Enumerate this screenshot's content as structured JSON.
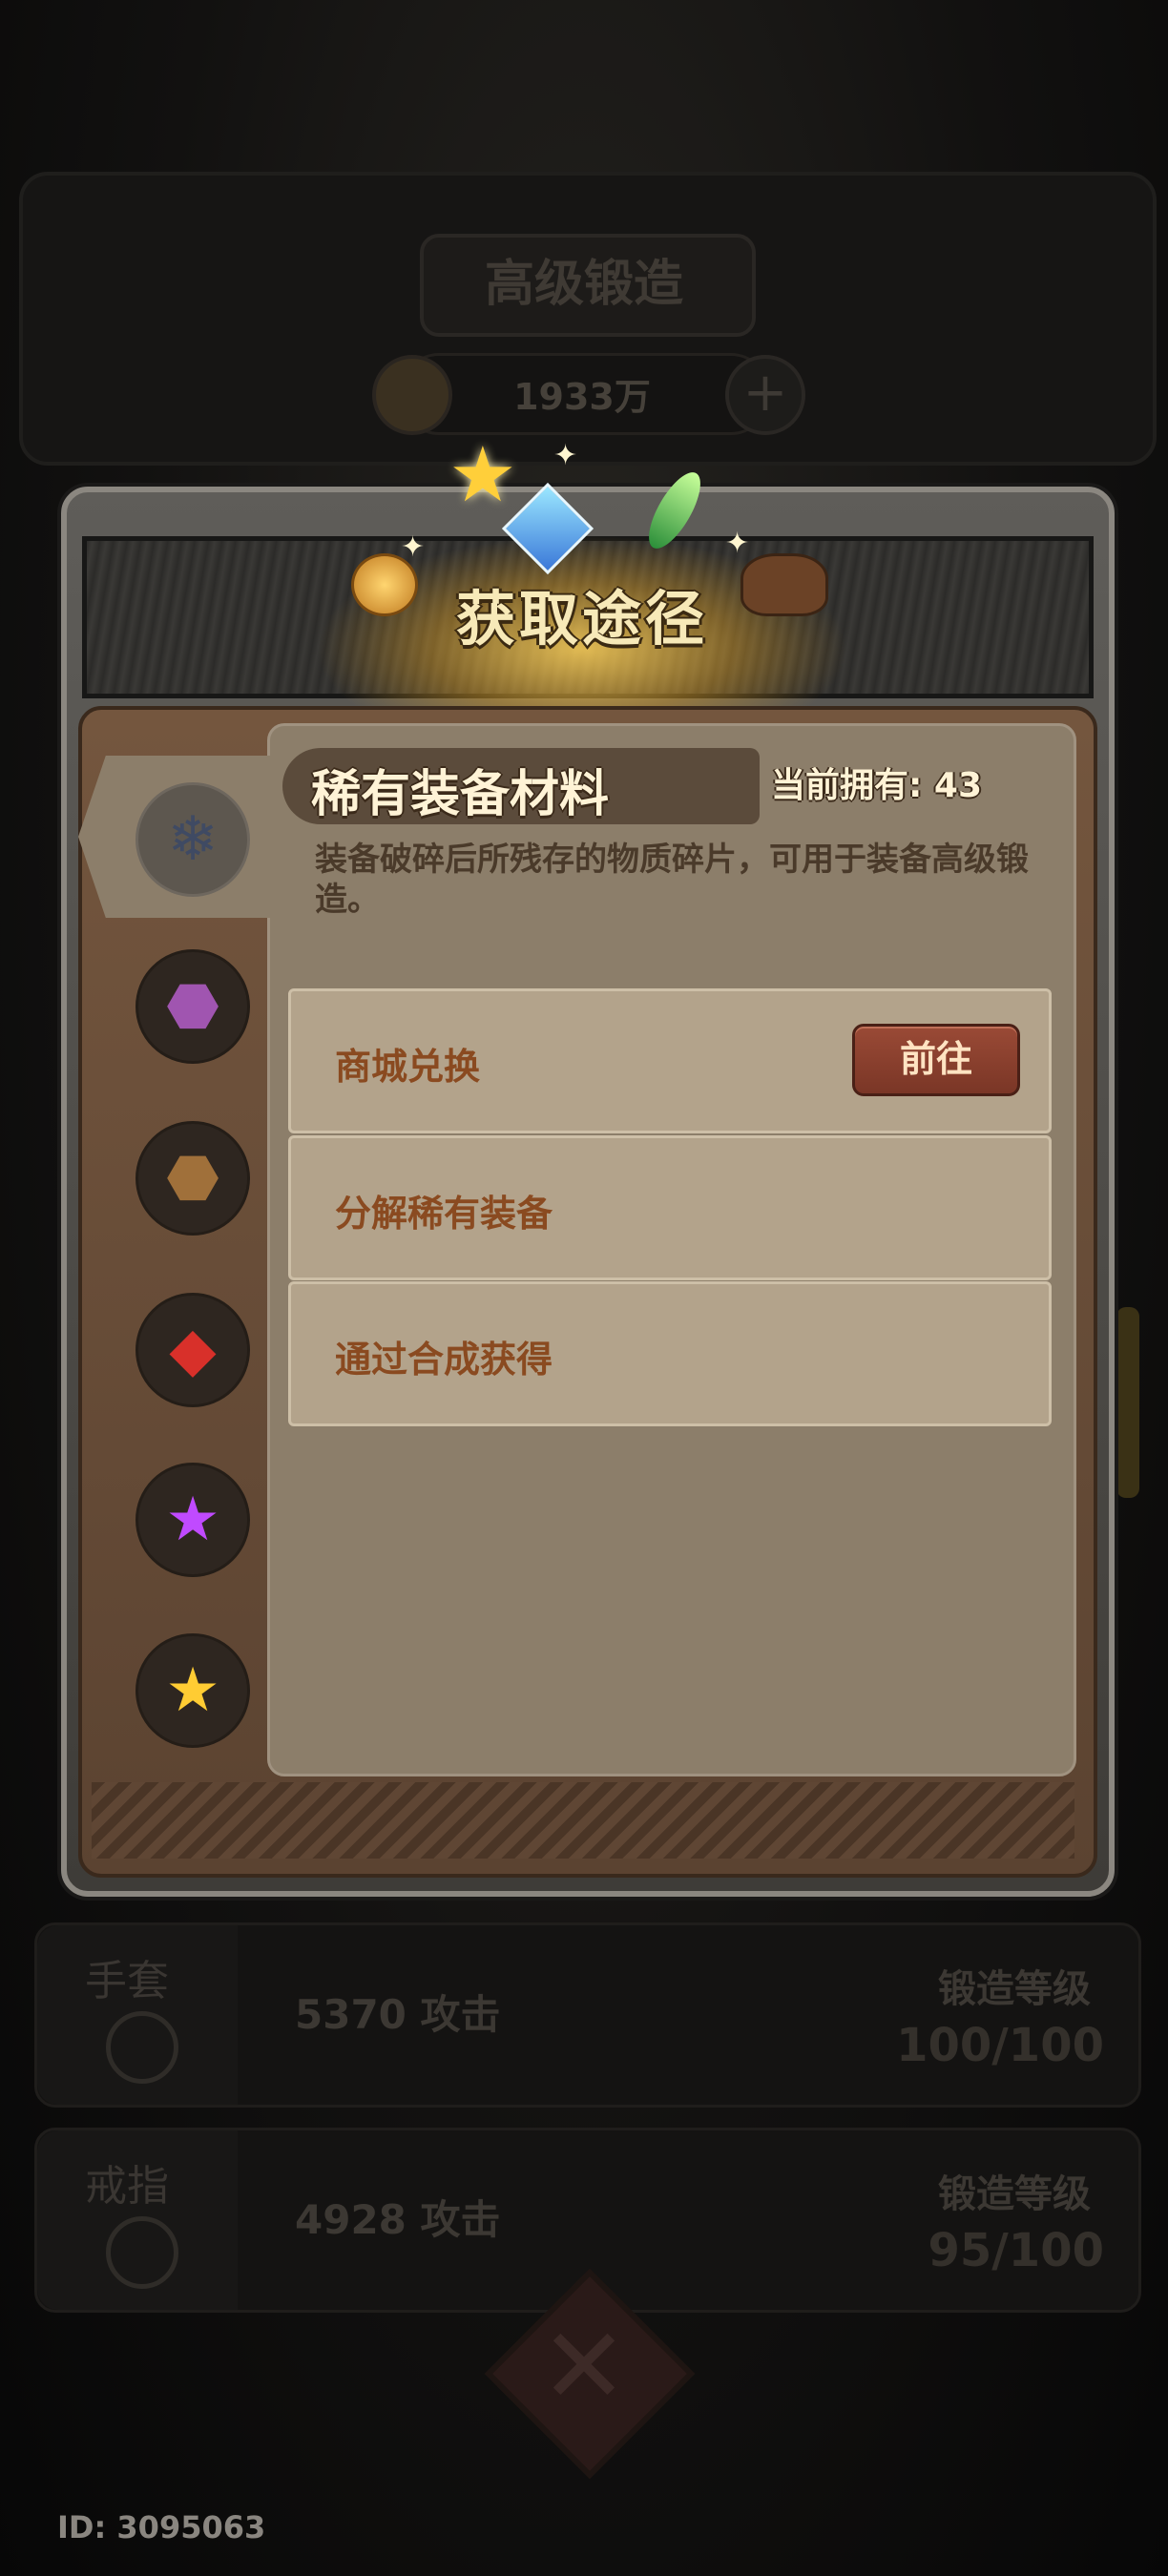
{
  "background": {
    "title": "高级锻造",
    "coins": "1933万",
    "plus_icon": "plus-icon",
    "rows": [
      {
        "name": "手套",
        "attack": "5370 攻击",
        "level_label": "锻造等级",
        "level_value": "100/100"
      },
      {
        "name": "戒指",
        "attack": "4928 攻击",
        "level_label": "锻造等级",
        "level_value": "95/100"
      }
    ],
    "player_id": "ID: 3095063"
  },
  "popup": {
    "title": "获取途径",
    "selected_item": {
      "name": "稀有装备材料",
      "owned": "当前拥有: 43",
      "description": "装备破碎后所残存的物质碎片，可用于装备高级锻造。"
    },
    "item_tabs": [
      {
        "icon": "fragment-icon",
        "glyph": "❄",
        "color": "#3f4a63"
      },
      {
        "icon": "purple-rock-icon",
        "glyph": "⬣",
        "color": "#a055b0"
      },
      {
        "icon": "brown-rock-icon",
        "glyph": "⬣",
        "color": "#a0703a"
      },
      {
        "icon": "red-crystal-icon",
        "glyph": "◆",
        "color": "#d8302a"
      },
      {
        "icon": "purple-star-icon",
        "glyph": "★",
        "color": "#c04aff"
      },
      {
        "icon": "gold-star-icon",
        "glyph": "★",
        "color": "#ffcc33"
      }
    ],
    "sources": [
      {
        "label": "商城兑换",
        "button": "前往"
      },
      {
        "label": "分解稀有装备"
      },
      {
        "label": "通过合成获得"
      }
    ]
  },
  "colors": {
    "accent_gold": "#f7e9b8",
    "button_red": "#8a3e2c",
    "panel": "#8c7e6a"
  }
}
